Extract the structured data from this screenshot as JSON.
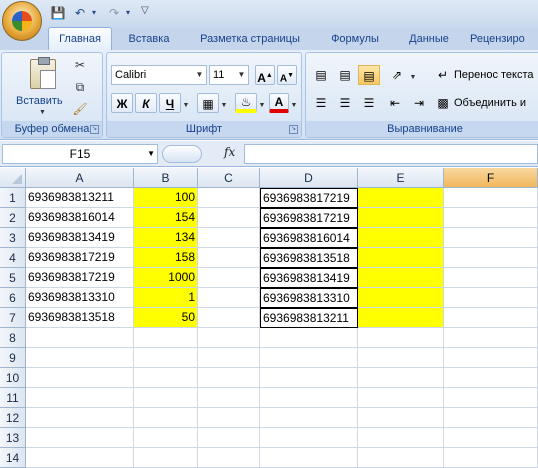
{
  "quick_access": {
    "save_icon": "save-icon",
    "undo_icon": "undo-icon",
    "redo_icon": "redo-icon"
  },
  "tabs": [
    "Главная",
    "Вставка",
    "Разметка страницы",
    "Формулы",
    "Данные",
    "Рецензиро"
  ],
  "active_tab": 0,
  "ribbon": {
    "clipboard": {
      "paste_label": "Вставить",
      "group_label": "Буфер обмена"
    },
    "font": {
      "font_name": "Calibri",
      "font_size": "11",
      "grow": "A",
      "shrink": "A",
      "bold": "Ж",
      "italic": "К",
      "underline": "Ч",
      "color_letter": "A",
      "group_label": "Шрифт"
    },
    "alignment": {
      "wrap_text": "Перенос текста",
      "merge": "Объединить и",
      "group_label": "Выравнивание"
    }
  },
  "formula_bar": {
    "name_box": "F15",
    "fx_label": "fx",
    "formula": ""
  },
  "columns": [
    "A",
    "B",
    "C",
    "D",
    "E",
    "F"
  ],
  "selected_column": "F",
  "rows": [
    "1",
    "2",
    "3",
    "4",
    "5",
    "6",
    "7",
    "8",
    "9",
    "10",
    "11",
    "12",
    "13",
    "14"
  ],
  "cells": {
    "A": [
      "6936983813211",
      "6936983816014",
      "6936983813419",
      "6936983817219",
      "6936983817219",
      "6936983813310",
      "6936983813518"
    ],
    "B": [
      "100",
      "154",
      "134",
      "158",
      "1000",
      "1",
      "50"
    ],
    "D": [
      "6936983817219",
      "6936983817219",
      "6936983816014",
      "6936983813518",
      "6936983813419",
      "6936983813310",
      "6936983813211"
    ]
  },
  "colors": {
    "highlight": "#ffff00",
    "selected_header": "#f5c46f",
    "ribbon_text": "#15428b"
  }
}
